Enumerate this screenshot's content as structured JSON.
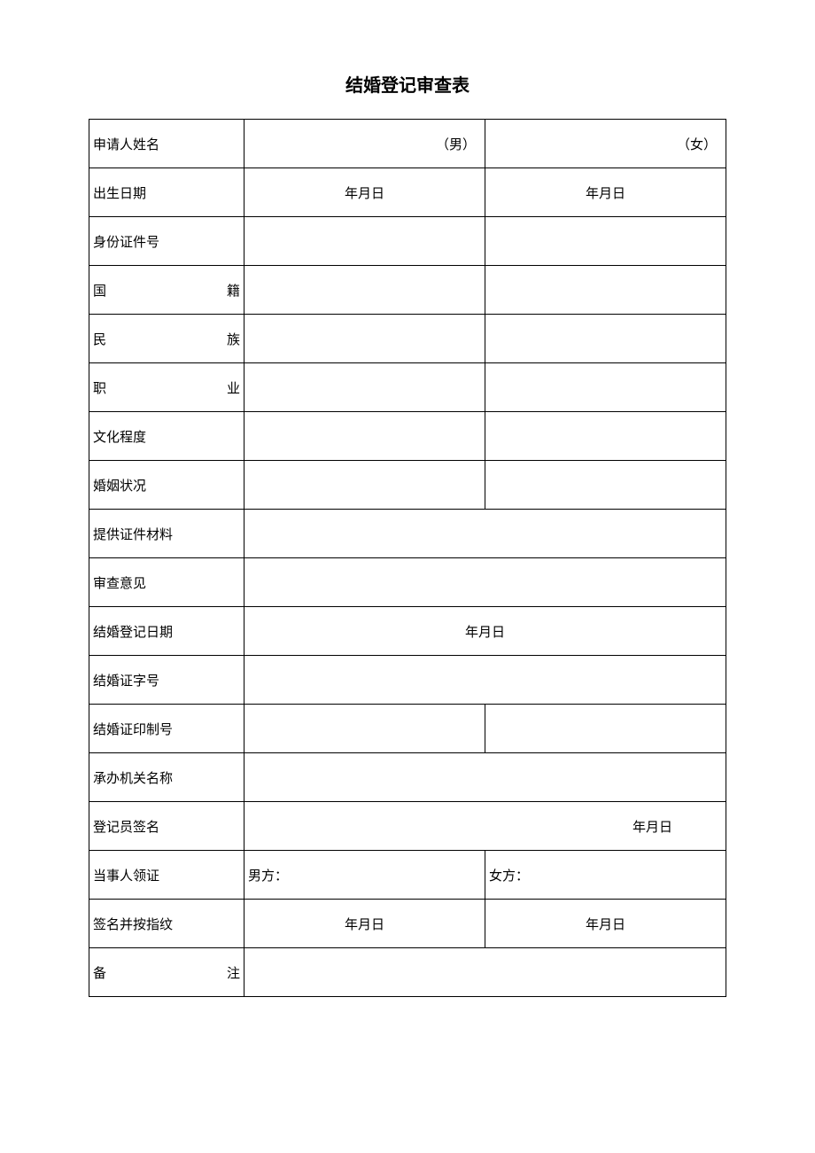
{
  "title": "结婚登记审查表",
  "labels": {
    "applicant_name": "申请人姓名",
    "birth_date": "出生日期",
    "id_number": "身份证件号",
    "nationality": "国　　　　　籍",
    "ethnicity": "民　　　　　族",
    "occupation": "职　　　　　业",
    "education": "文化程度",
    "marital_status": "婚姻状况",
    "documents": "提供证件材料",
    "review_opinion": "审查意见",
    "registration_date": "结婚登记日期",
    "certificate_number": "结婚证字号",
    "print_number": "结婚证印制号",
    "agency_name": "承办机关名称",
    "registrar_signature": "登记员签名",
    "party_receipt": "当事人领证",
    "signature_fingerprint": "签名并按指纹",
    "remarks": "备　　　　　注"
  },
  "values": {
    "male_suffix": "（男）",
    "female_suffix": "（女）",
    "date_ymd": "年月日",
    "male_party": "男方：",
    "female_party": "女方："
  }
}
